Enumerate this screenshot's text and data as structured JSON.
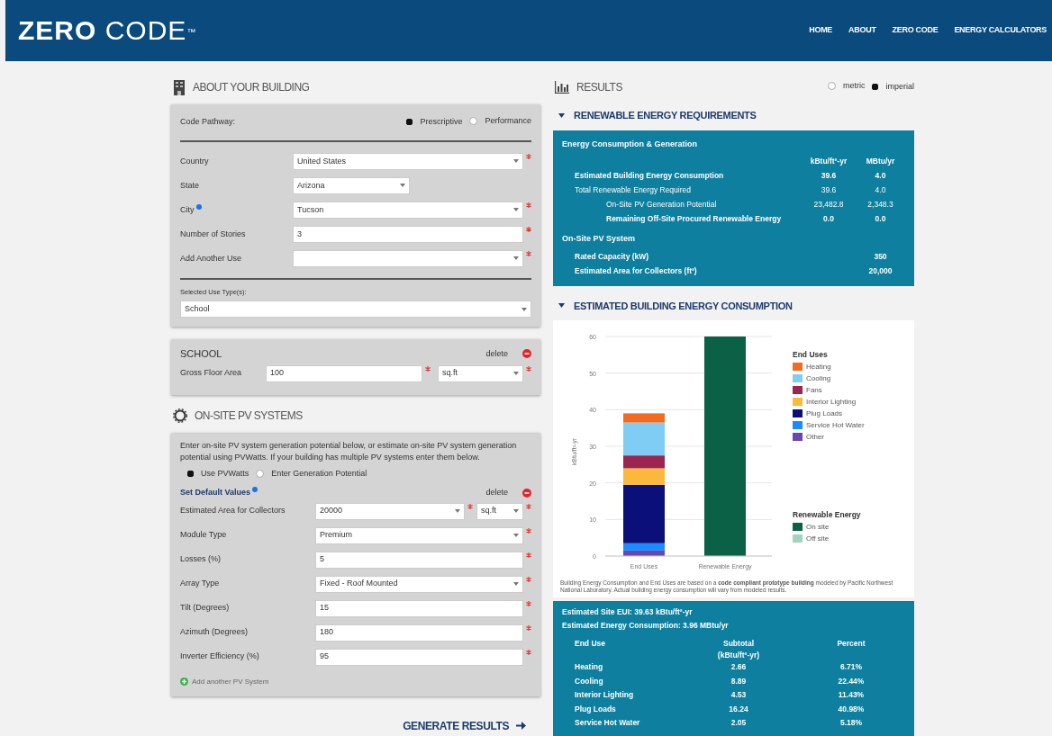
{
  "header": {
    "logo_bold": "ZERO",
    "logo_light": "CODE",
    "logo_mark": "™",
    "nav": [
      "HOME",
      "ABOUT",
      "ZERO CODE",
      "ENERGY CALCULATORS"
    ]
  },
  "building": {
    "title": "ABOUT YOUR BUILDING",
    "pathway": {
      "label": "Code Pathway:",
      "options": [
        {
          "label": "Prescriptive",
          "selected": true
        },
        {
          "label": "Performance",
          "selected": false
        }
      ]
    },
    "fields": [
      {
        "label": "Country",
        "value": "United States",
        "kind": "select",
        "required": true,
        "info": false
      },
      {
        "label": "State",
        "value": "Arizona",
        "kind": "short-select",
        "required": false,
        "info": false
      },
      {
        "label": "City",
        "value": "Tucson",
        "kind": "select",
        "required": true,
        "info": true
      },
      {
        "label": "Number of Stories",
        "value": "3",
        "kind": "text",
        "required": true,
        "info": false
      },
      {
        "label": "Add Another Use",
        "kind": "select",
        "required": true,
        "info": false
      }
    ],
    "selected_uses": {
      "label": "Selected Use Type(s):",
      "value": "School"
    }
  },
  "use_card": {
    "title": "SCHOOL",
    "delete": "delete",
    "field": {
      "label": "Gross Floor Area",
      "value": "100",
      "unit": "sq.ft"
    }
  },
  "pv": {
    "title": "ON-SITE PV SYSTEMS",
    "intro": "Enter on-site PV system generation potential below, or estimate on-site PV system generation potential using PVWatts. If your building has multiple PV systems enter them below.",
    "methods": [
      {
        "label": "Use PVWatts",
        "selected": true
      },
      {
        "label": "Enter Generation Potential",
        "selected": false
      }
    ],
    "system": {
      "title": "Set Default Values",
      "delete": "delete",
      "fields": [
        {
          "label": "Estimated Area for Collectors",
          "value": "20000",
          "kind": "area",
          "unit": "sq.ft"
        },
        {
          "label": "Module Type",
          "value": "Premium",
          "kind": "select"
        },
        {
          "label": "Losses (%)",
          "value": "5",
          "kind": "text"
        },
        {
          "label": "Array Type",
          "value": "Fixed - Roof Mounted",
          "kind": "select"
        },
        {
          "label": "Tilt (Degrees)",
          "value": "15",
          "kind": "text"
        },
        {
          "label": "Azimuth (Degrees)",
          "value": "180",
          "kind": "text"
        },
        {
          "label": "Inverter Efficiency (%)",
          "value": "95",
          "kind": "text"
        }
      ]
    },
    "add": "Add another PV System"
  },
  "generate": "GENERATE RESULTS",
  "results": {
    "title": "RESULTS",
    "units": [
      {
        "label": "metric",
        "selected": false
      },
      {
        "label": "imperial",
        "selected": true
      }
    ]
  },
  "renewable": {
    "heading": "RENEWABLE ENERGY REQUIREMENTS",
    "expanded": true,
    "group_title": "Energy Consumption & Generation",
    "columns": [
      "kBtu/ft²-yr",
      "MBtu/yr"
    ],
    "rows": [
      {
        "label": "Estimated Building Energy Consumption",
        "values": [
          "39.6",
          "4.0"
        ],
        "emphasis": true
      },
      {
        "label": "Total Renewable Energy Required",
        "values": [
          "39.6",
          "4.0"
        ],
        "emphasis": false,
        "children": [
          {
            "label": "On-Site PV Generation Potential",
            "values": [
              "23,482.8",
              "2,348.3"
            ],
            "emphasis": false
          },
          {
            "label": "Remaining Off-Site Procured Renewable Energy",
            "values": [
              "0.0",
              "0.0"
            ],
            "emphasis": true
          }
        ]
      }
    ],
    "pv_title": "On-Site PV System",
    "pv_rows": [
      {
        "label": "Rated Capacity (kW)",
        "value": "350"
      },
      {
        "label": "Estimated Area for Collectors (ft²)",
        "value": "20,000"
      }
    ]
  },
  "consumption": {
    "heading": "ESTIMATED BUILDING ENERGY CONSUMPTION",
    "expanded": true,
    "chart_data": {
      "type": "bar",
      "stacked": true,
      "grid": true,
      "legend": true,
      "ylabel": "kBtu/ft²-yr",
      "categories": [
        "End Uses",
        "Renewable Energy"
      ],
      "ylim": [
        0,
        60
      ],
      "yticks": [
        0,
        10,
        20,
        30,
        40,
        50,
        60
      ],
      "series": [
        {
          "name": "Heating",
          "color": "#f26b21",
          "values": [
            2.5,
            null
          ]
        },
        {
          "name": "Cooling",
          "color": "#7fcdf5",
          "values": [
            9,
            null
          ]
        },
        {
          "name": "Fans",
          "color": "#9b2450",
          "values": [
            3.5,
            null
          ]
        },
        {
          "name": "Interior Lighting",
          "color": "#fbb93b",
          "values": [
            4.5,
            null
          ]
        },
        {
          "name": "Plug Loads",
          "color": "#0a0f7a",
          "values": [
            16,
            null
          ]
        },
        {
          "name": "Service Hot Water",
          "color": "#1a8cff",
          "values": [
            2,
            null
          ]
        },
        {
          "name": "Other",
          "color": "#6b46b0",
          "values": [
            1.5,
            null
          ]
        },
        {
          "name": "On site",
          "color": "#0b6146",
          "values": [
            null,
            60
          ]
        },
        {
          "name": "Off site",
          "color": "#9fd4bf",
          "values": [
            null,
            null
          ]
        }
      ]
    },
    "legend_titles": [
      "End Uses",
      "Renewable Energy"
    ],
    "note": "Building Energy Consumption and End Uses are based on a **code compliant prototype building** modeled by Pacific Northwest National Laboratory. Actual building energy consumption will vary from modeled results."
  },
  "summary": {
    "lines": [
      "Estimated Site EUI: 39.63 kBtu/ft²-yr",
      "Estimated Energy Consumption: 3.96 MBtu/yr"
    ],
    "columns": [
      "End Use",
      "Subtotal",
      "Percent"
    ],
    "subunit": "(kBtu/ft²-yr)",
    "rows": [
      {
        "end_use": "Heating",
        "subtotal": "2.66",
        "percent": "6.71%"
      },
      {
        "end_use": "Cooling",
        "subtotal": "8.89",
        "percent": "22.44%"
      },
      {
        "end_use": "Interior Lighting",
        "subtotal": "4.53",
        "percent": "11.43%"
      },
      {
        "end_use": "Plug Loads",
        "subtotal": "16.24",
        "percent": "40.98%"
      },
      {
        "end_use": "Service Hot Water",
        "subtotal": "2.05",
        "percent": "5.18%"
      }
    ]
  }
}
